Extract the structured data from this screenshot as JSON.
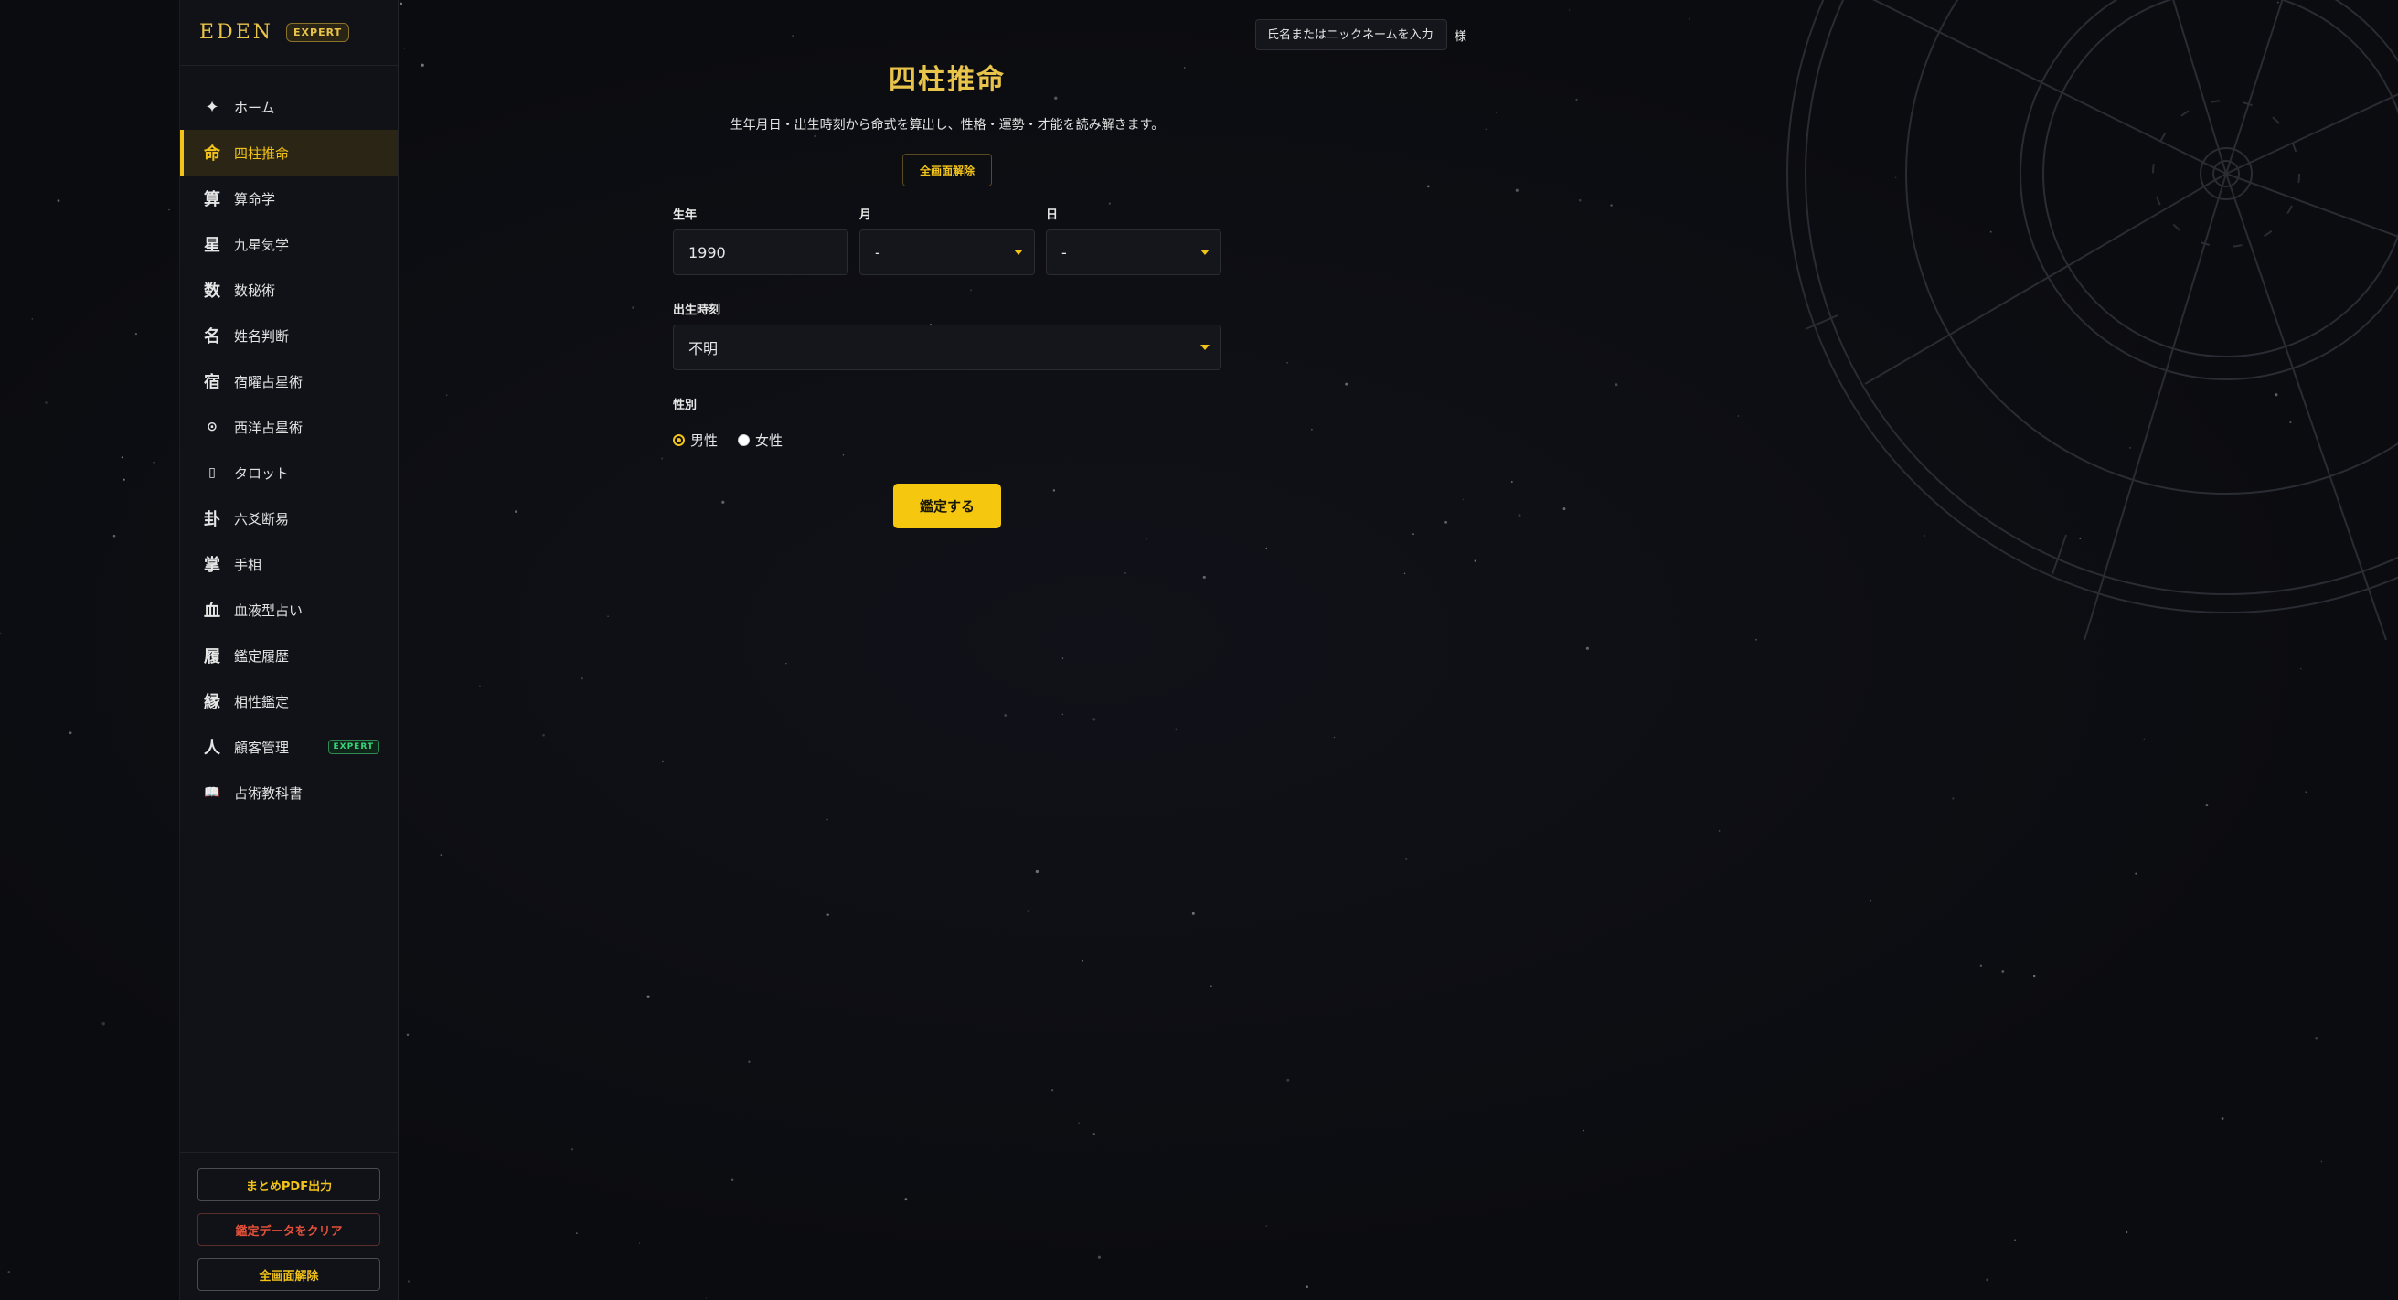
{
  "brand": {
    "logo": "EDEN",
    "badge": "EXPERT"
  },
  "sidebar": {
    "items": [
      {
        "icon": "✦",
        "icon_name": "sparkle-icon",
        "label": "ホーム"
      },
      {
        "icon": "命",
        "icon_name": "kanji-mei-icon",
        "label": "四柱推命",
        "active": true
      },
      {
        "icon": "算",
        "icon_name": "kanji-san-icon",
        "label": "算命学"
      },
      {
        "icon": "星",
        "icon_name": "kanji-hoshi-icon",
        "label": "九星気学"
      },
      {
        "icon": "数",
        "icon_name": "kanji-kazu-icon",
        "label": "数秘術"
      },
      {
        "icon": "名",
        "icon_name": "kanji-na-icon",
        "label": "姓名判断"
      },
      {
        "icon": "宿",
        "icon_name": "kanji-yado-icon",
        "label": "宿曜占星術"
      },
      {
        "icon": "⊙",
        "icon_name": "sun-circle-icon",
        "label": "西洋占星術"
      },
      {
        "icon": "▯",
        "icon_name": "card-icon",
        "label": "タロット"
      },
      {
        "icon": "卦",
        "icon_name": "kanji-ke-icon",
        "label": "六爻断易"
      },
      {
        "icon": "掌",
        "icon_name": "kanji-te-icon",
        "label": "手相"
      },
      {
        "icon": "血",
        "icon_name": "kanji-chi-icon",
        "label": "血液型占い"
      },
      {
        "icon": "履",
        "icon_name": "kanji-reki-icon",
        "label": "鑑定履歴"
      },
      {
        "icon": "縁",
        "icon_name": "kanji-en-icon",
        "label": "相性鑑定"
      },
      {
        "icon": "人",
        "icon_name": "kanji-hito-icon",
        "label": "顧客管理",
        "badge": "EXPERT"
      },
      {
        "icon": "📖",
        "icon_name": "book-icon",
        "label": "占術教科書"
      }
    ],
    "bottom_buttons": {
      "pdf": "まとめPDF出力",
      "clear_data": "鑑定データをクリア",
      "fullscreen_off": "全画面解除"
    }
  },
  "header": {
    "name_placeholder": "氏名またはニックネームを入力",
    "name_suffix": "様"
  },
  "main": {
    "title": "四柱推命",
    "description": "生年月日・出生時刻から命式を算出し、性格・運勢・才能を読み解きます。",
    "clear_button": "全画面解除",
    "year_label": "生年",
    "year_value": "1990",
    "month_label": "月",
    "month_value": "-",
    "day_label": "日",
    "day_value": "-",
    "time_label": "出生時刻",
    "time_value": "不明",
    "gender_label": "性別",
    "gender_male": "男性",
    "gender_female": "女性",
    "gender_selected": "male",
    "submit": "鑑定する"
  },
  "colors": {
    "accent": "#f2c318",
    "background": "#0c0d12",
    "danger": "#e0503a",
    "expert_green": "#37d67a"
  }
}
